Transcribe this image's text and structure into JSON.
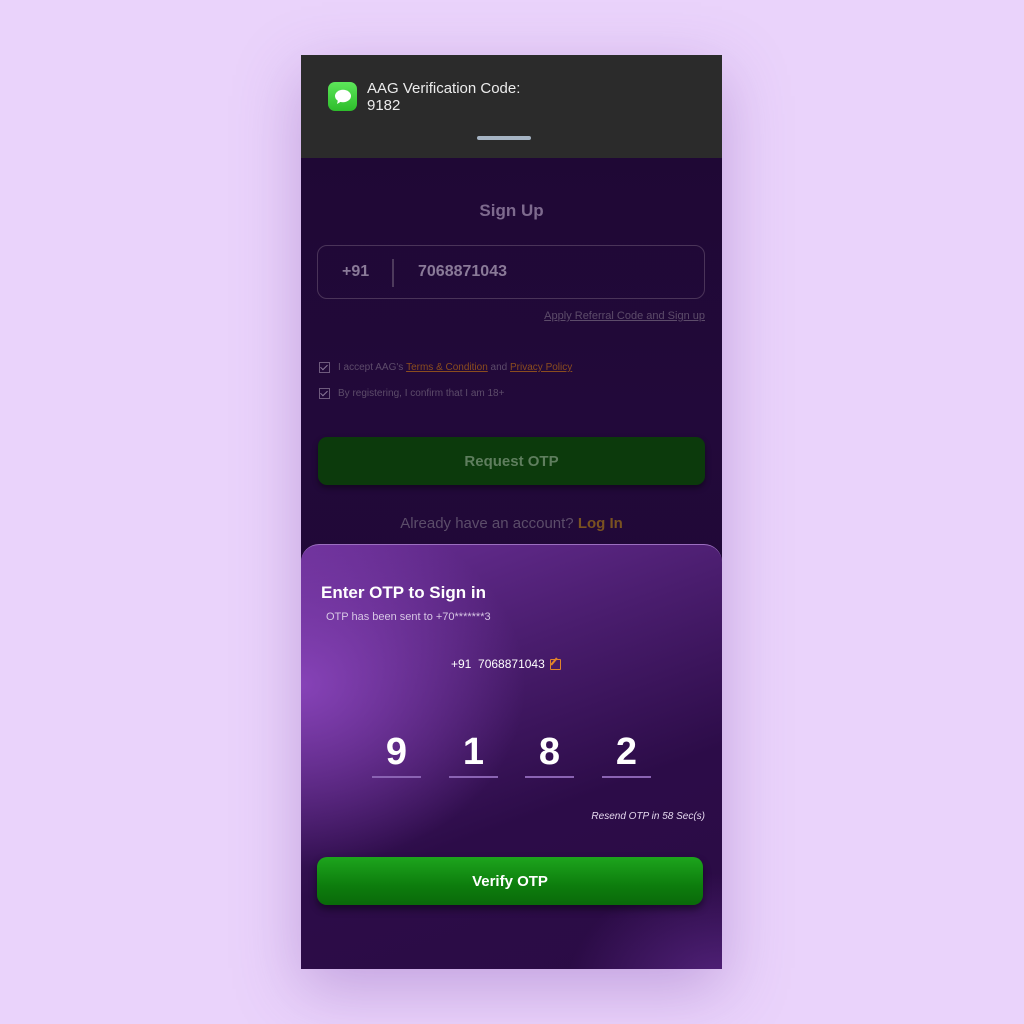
{
  "notification": {
    "app_icon": "messages-icon",
    "title": "AAG Verification Code:",
    "code": "9182"
  },
  "signup": {
    "title": "Sign Up",
    "country_code": "+91",
    "phone_number": "7068871043",
    "referral_link": "Apply Referral Code and Sign up",
    "terms_prefix": "I accept AAG's",
    "terms_link": "Terms & Condition",
    "terms_and": "and",
    "privacy_link": "Privacy Policy",
    "age_confirm": "By registering, I confirm that I am 18+",
    "request_otp": "Request OTP",
    "already_account": "Already have an account?",
    "login_link": "Log In"
  },
  "otp_sheet": {
    "title": "Enter OTP to Sign in",
    "subtitle": "OTP has been sent to +70*******3",
    "country_code": "+91",
    "phone_number": "7068871043",
    "digits": [
      "9",
      "1",
      "8",
      "2"
    ],
    "resend_text": "Resend OTP in 58 Sec(s)",
    "verify_button": "Verify OTP"
  },
  "colors": {
    "background": "#ead3fb",
    "accent_green": "#1da51d",
    "link_orange": "#e0842b"
  }
}
